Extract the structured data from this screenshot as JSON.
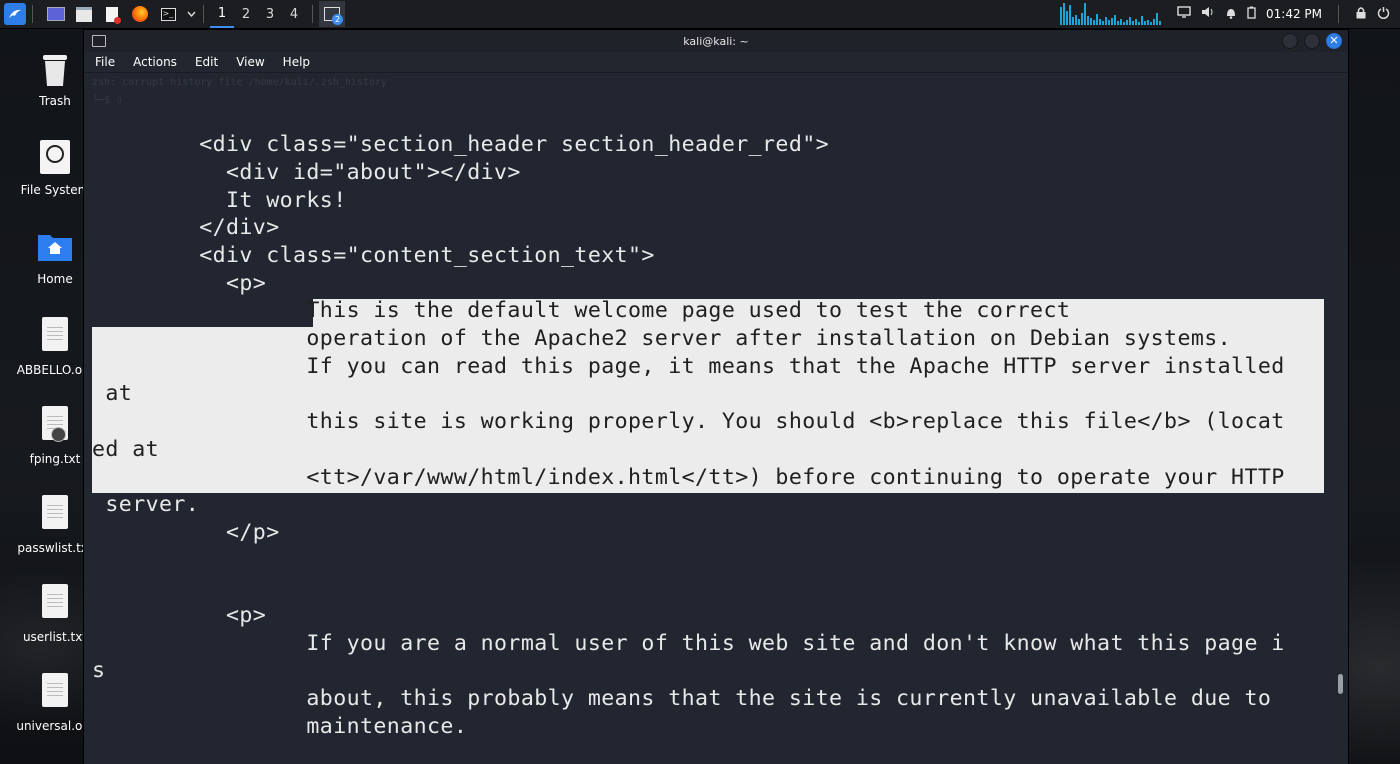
{
  "taskbar": {
    "workspaces": [
      "1",
      "2",
      "3",
      "4"
    ],
    "terminal_badge": "2",
    "clock": "01:42 PM"
  },
  "desktop": {
    "icons": [
      {
        "label": "Trash",
        "icon": "trash-icon"
      },
      {
        "label": "File System",
        "icon": "drive-icon"
      },
      {
        "label": "Home",
        "icon": "home-folder-icon"
      },
      {
        "label": "ABBELLO.o...",
        "icon": "document-icon"
      },
      {
        "label": "fping.txt",
        "icon": "locked-document-icon"
      },
      {
        "label": "passwlist.txt",
        "icon": "document-icon"
      },
      {
        "label": "userlist.txt",
        "icon": "document-icon"
      },
      {
        "label": "universal.o...",
        "icon": "document-icon"
      }
    ]
  },
  "window": {
    "title": "kali@kali: ~",
    "close_glyph": "✕",
    "menu": [
      "File",
      "Actions",
      "Edit",
      "View",
      "Help"
    ]
  },
  "terminal": {
    "ghost_line_1": "zsh: corrupt history file /home/kali/.zsh_history",
    "ghost_line_2": "└─$ ▯",
    "lines": [
      "        <div class=\"section_header section_header_red\">",
      "          <div id=\"about\"></div>",
      "          It works!",
      "        </div>",
      "        <div class=\"content_section_text\">",
      "          <p>",
      "                This is the default welcome page used to test the correct",
      "                operation of the Apache2 server after installation on Debian systems.",
      "                If you can read this page, it means that the Apache HTTP server installed",
      " at",
      "                this site is working properly. You should <b>replace this file</b> (locat",
      "ed at",
      "                <tt>/var/www/html/index.html</tt>) before continuing to operate your HTTP",
      " server.",
      "          </p>",
      "",
      "",
      "          <p>",
      "                If you are a normal user of this web site and don't know what this page i",
      "s",
      "                about, this probably means that the site is currently unavailable due to",
      "                maintenance."
    ]
  },
  "colors": {
    "terminal_bg": "#212630",
    "terminal_fg": "#e8e8e8",
    "selection_bg": "#ececec",
    "accent": "#2f7ee7"
  }
}
